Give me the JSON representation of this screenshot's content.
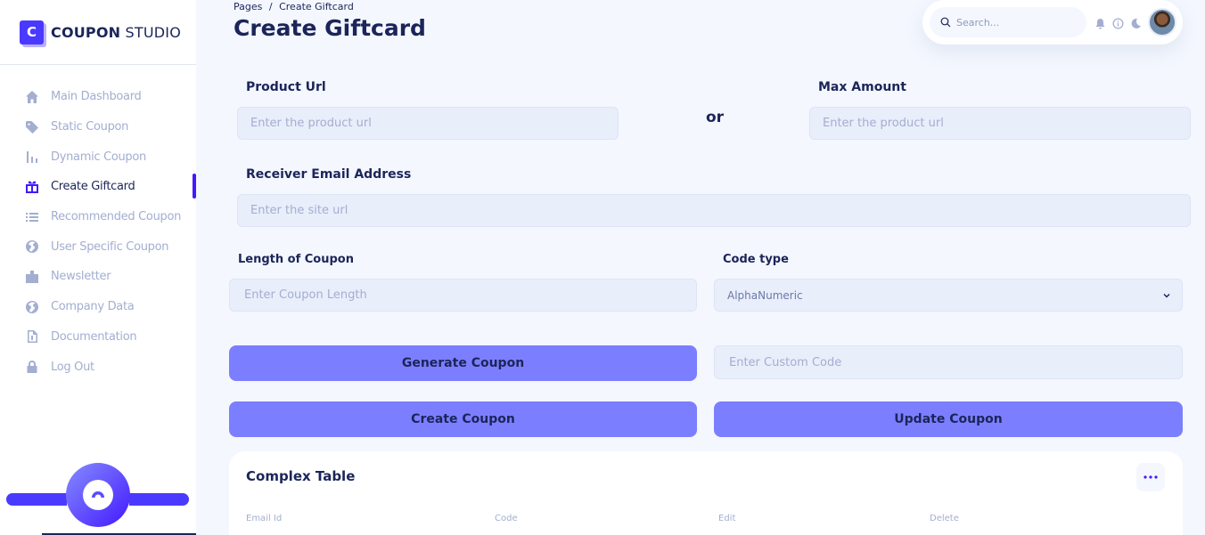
{
  "brand": {
    "logo_letter": "C",
    "name_bold": "COUPON",
    "name_light": " STUDIO"
  },
  "sidebar": {
    "items": [
      {
        "label": "Main Dashboard",
        "icon": "home-icon"
      },
      {
        "label": "Static Coupon",
        "icon": "tag-icon"
      },
      {
        "label": "Dynamic Coupon",
        "icon": "bar-chart-icon"
      },
      {
        "label": "Create Giftcard",
        "icon": "gift-icon",
        "active": true
      },
      {
        "label": "Recommended Coupon",
        "icon": "list-icon"
      },
      {
        "label": "User Specific Coupon",
        "icon": "globe-icon"
      },
      {
        "label": "Newsletter",
        "icon": "folder-icon"
      },
      {
        "label": "Company Data",
        "icon": "globe-icon"
      },
      {
        "label": "Documentation",
        "icon": "document-icon"
      },
      {
        "label": "Log Out",
        "icon": "lock-icon"
      }
    ]
  },
  "header": {
    "breadcrumb": [
      "Pages",
      "/",
      "Create Giftcard"
    ],
    "title": "Create Giftcard",
    "search_placeholder": "Search..."
  },
  "form": {
    "product_url_label": "Product Url",
    "product_url_placeholder": "Enter the product url",
    "or_text": "or",
    "max_amount_label": "Max Amount",
    "max_amount_placeholder": "Enter the product url",
    "receiver_email_label": "Receiver Email Address",
    "receiver_email_placeholder": "Enter the site url",
    "coupon_length_label": "Length of Coupon",
    "coupon_length_placeholder": "Enter Coupon Length",
    "code_type_label": "Code type",
    "code_type_value": "AlphaNumeric",
    "custom_code_placeholder": "Enter Custom Code",
    "generate_label": "Generate Coupon",
    "create_label": "Create Coupon",
    "update_label": "Update Coupon"
  },
  "table": {
    "title": "Complex Table",
    "columns": [
      "Email Id",
      "Code",
      "Edit",
      "Delete"
    ]
  },
  "colors": {
    "accent": "#4318ff",
    "button": "#7b7fff",
    "text": "#1b2559",
    "muted": "#a3aed0"
  }
}
